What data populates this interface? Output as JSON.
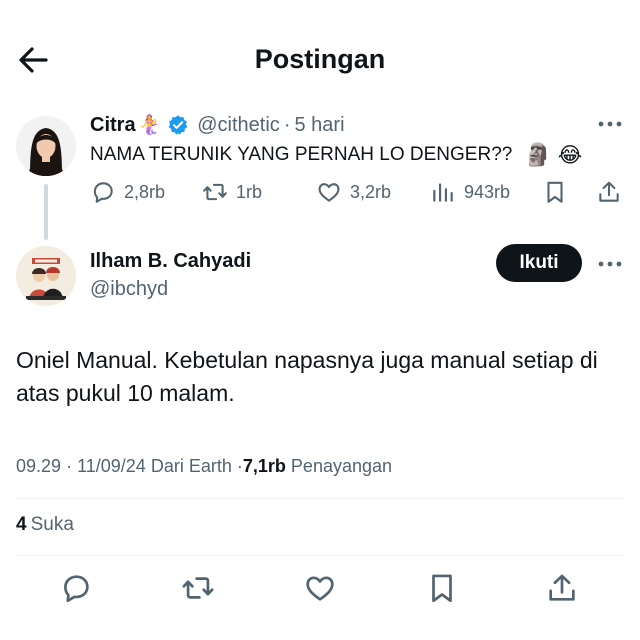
{
  "header": {
    "title": "Postingan"
  },
  "parent_tweet": {
    "name": "Citra",
    "name_emoji": "🧜‍♀️",
    "handle": "@cithetic",
    "separator": "·",
    "time": "5 hari",
    "text": "NAMA TERUNIK YANG PERNAH LO DENGER??",
    "text_emojis": [
      "🗿",
      "😂"
    ],
    "actions": {
      "replies": "2,8rb",
      "reposts": "1rb",
      "likes": "3,2rb",
      "views": "943rb"
    }
  },
  "main_tweet": {
    "name": "Ilham B. Cahyadi",
    "handle": "@ibchyd",
    "follow_label": "Ikuti",
    "text": "Oniel Manual. Kebetulan napasnya juga manual setiap di atas pukul 10 malam.",
    "meta": {
      "time": "09.29",
      "date": "11/09/24",
      "source": "Dari Earth",
      "views_count": "7,1rb",
      "views_label": "Penayangan",
      "separator": "·"
    },
    "likes_count": "4",
    "likes_label": "Suka"
  },
  "icons": {
    "back": "arrow-left-icon",
    "verified": "verified-badge-icon",
    "more": "more-dots-icon",
    "reply": "reply-icon",
    "repost": "repost-icon",
    "like": "heart-icon",
    "views": "views-chart-icon",
    "bookmark": "bookmark-icon",
    "share": "share-icon"
  },
  "colors": {
    "text": "#0f1419",
    "muted": "#536471",
    "verified": "#1d9bf0",
    "follow_bg": "#0f1419",
    "divider": "#eff3f4"
  }
}
